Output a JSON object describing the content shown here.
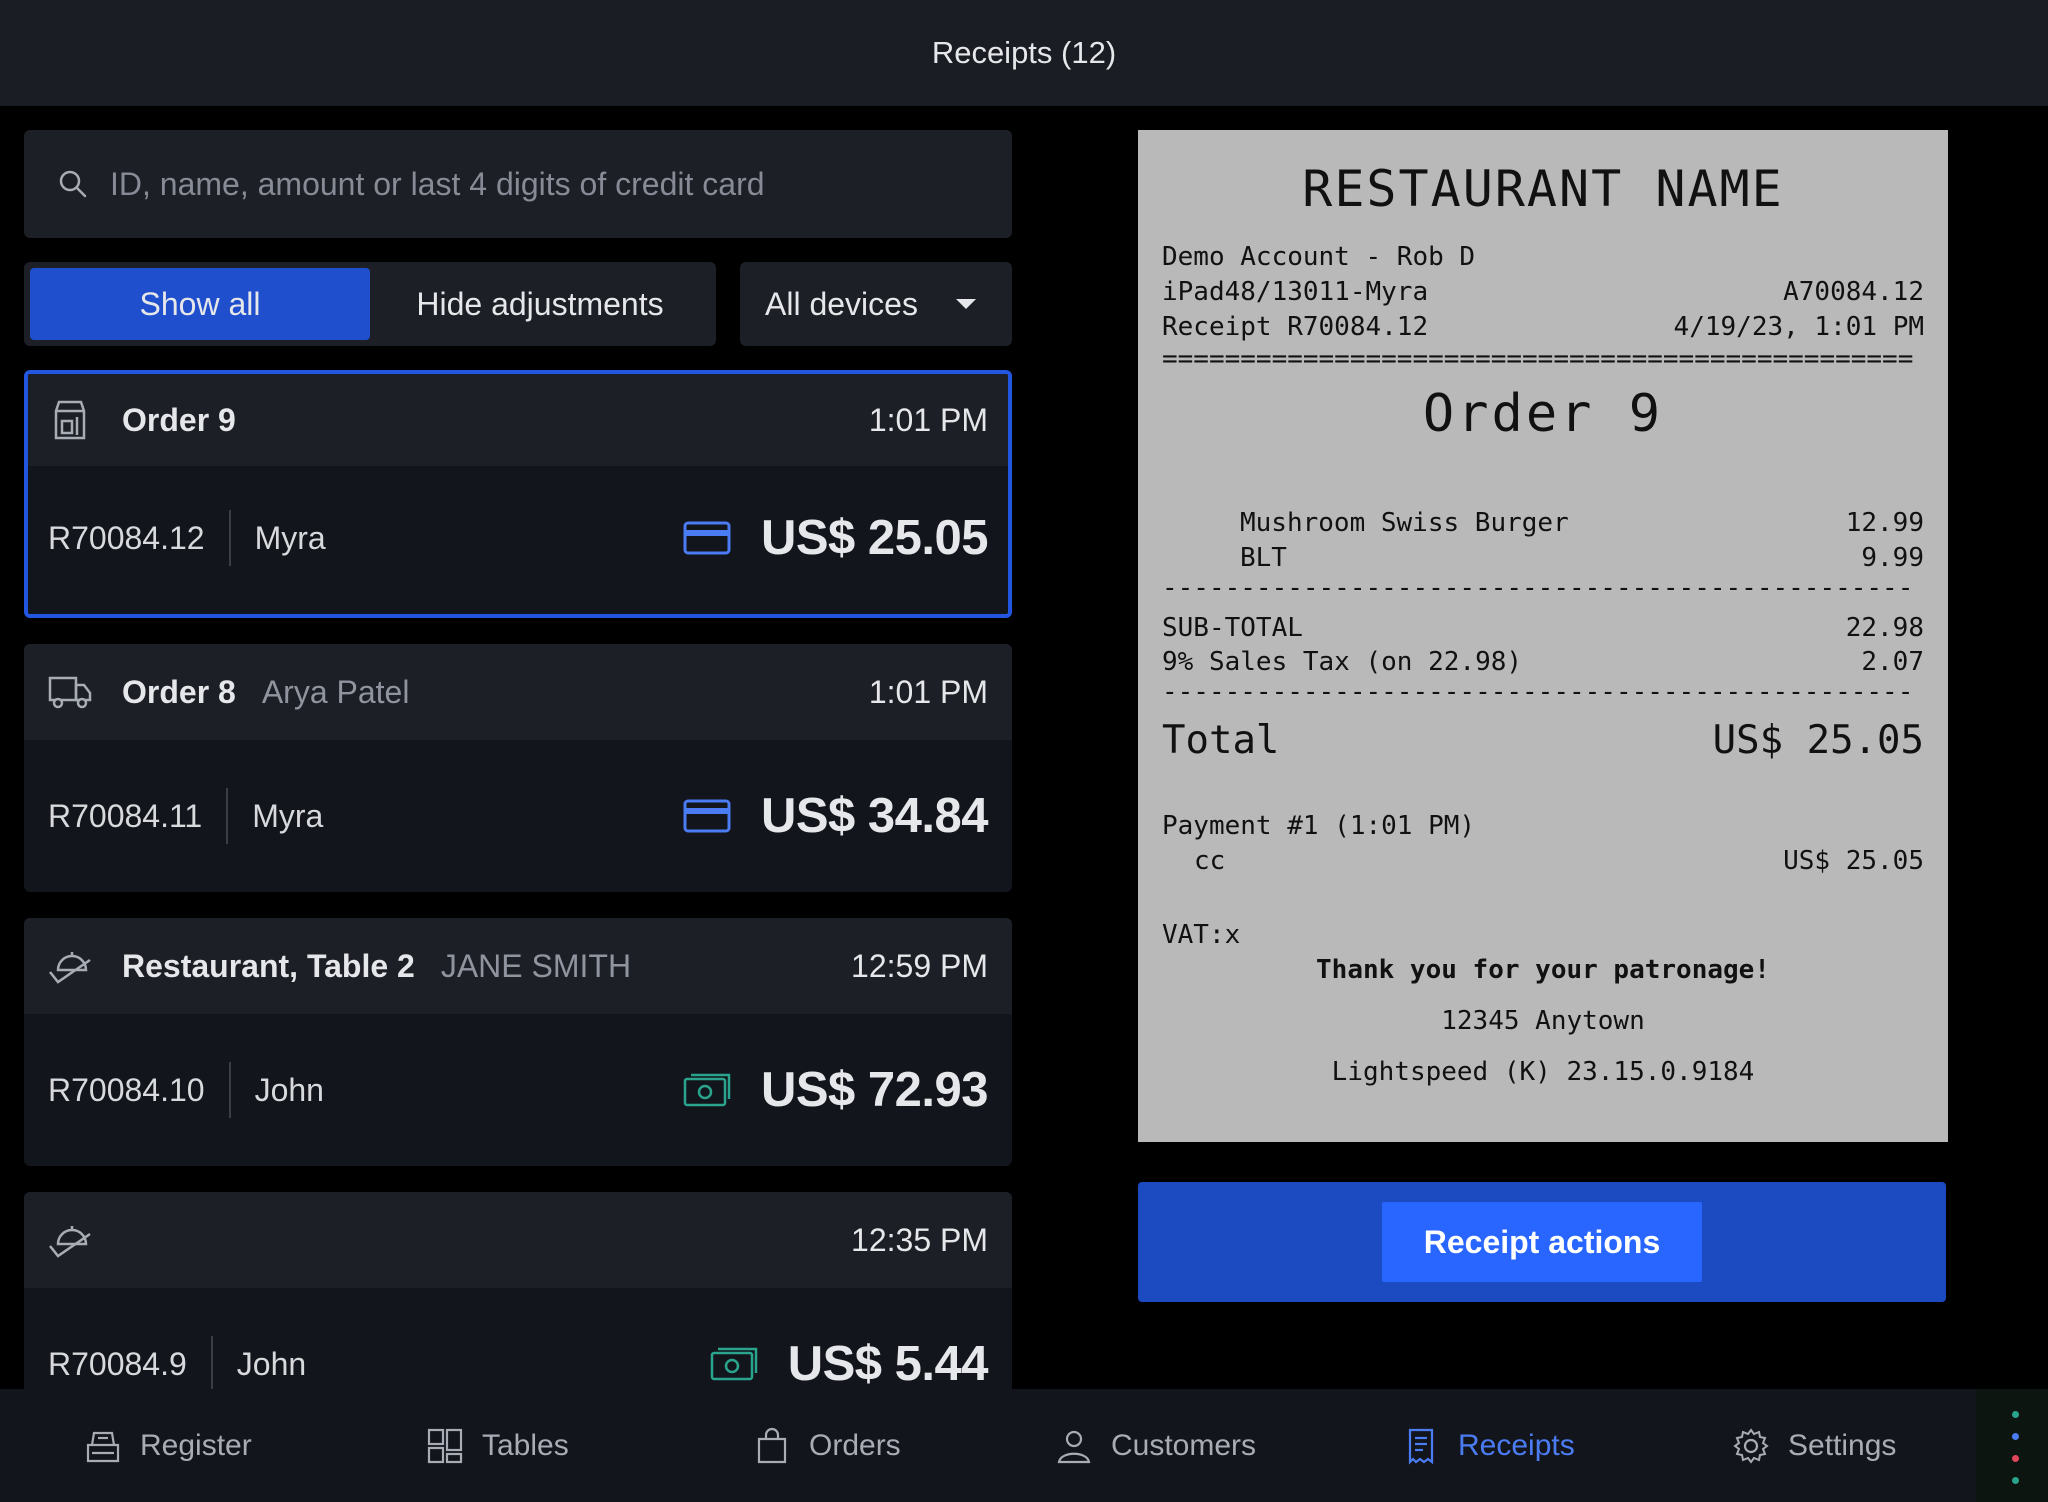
{
  "header": {
    "title": "Receipts (12)"
  },
  "search": {
    "placeholder": "ID, name, amount or last 4 digits of credit card"
  },
  "filters": {
    "show_all": "Show all",
    "hide_adjustments": "Hide adjustments",
    "devices": "All devices"
  },
  "receipts": [
    {
      "order": "Order 9",
      "customer": "",
      "time": "1:01 PM",
      "id": "R70084.12",
      "employee": "Myra",
      "amount": "US$ 25.05",
      "payment_icon": "credit-card-icon",
      "type_icon": "store-icon"
    },
    {
      "order": "Order 8",
      "customer": "Arya  Patel",
      "time": "1:01 PM",
      "id": "R70084.11",
      "employee": "Myra",
      "amount": "US$ 34.84",
      "payment_icon": "credit-card-icon",
      "type_icon": "delivery-truck-icon"
    },
    {
      "order": "Restaurant, Table 2",
      "customer": "JANE SMITH",
      "time": "12:59 PM",
      "id": "R70084.10",
      "employee": "John",
      "amount": "US$ 72.93",
      "payment_icon": "cash-icon",
      "type_icon": "dine-in-icon"
    },
    {
      "order": "",
      "customer": "",
      "time": "12:35 PM",
      "id": "R70084.9",
      "employee": "John",
      "amount": "US$ 5.44",
      "payment_icon": "cash-icon",
      "type_icon": "dine-in-icon"
    }
  ],
  "receipt_preview": {
    "restaurant": "RESTAURANT NAME",
    "account": "Demo Account - Rob D",
    "device": "iPad48/13011-Myra",
    "device_ref": "A70084.12",
    "receipt_no": "Receipt R70084.12",
    "datetime": "4/19/23, 1:01 PM",
    "double_rule": "================================================",
    "rule": "------------------------------------------------",
    "order": "Order 9",
    "items": [
      {
        "name": "Mushroom Swiss Burger",
        "price": "12.99"
      },
      {
        "name": "BLT",
        "price": "9.99"
      }
    ],
    "subtotal_label": "SUB-TOTAL",
    "subtotal": "22.98",
    "tax_label": "9% Sales Tax (on 22.98)",
    "tax": "2.07",
    "total_label": "Total",
    "total": "US$ 25.05",
    "payment_label": "Payment #1 (1:01 PM)",
    "payment_method": "cc",
    "payment_amount": "US$ 25.05",
    "vat": "VAT:x",
    "thanks": "Thank you for your patronage!",
    "address": "12345 Anytown",
    "version": "Lightspeed (K) 23.15.0.9184"
  },
  "receipt_actions": "Receipt actions",
  "tabs": [
    {
      "label": "Register",
      "icon": "register-icon"
    },
    {
      "label": "Tables",
      "icon": "tables-icon"
    },
    {
      "label": "Orders",
      "icon": "shopping-bag-icon"
    },
    {
      "label": "Customers",
      "icon": "person-icon"
    },
    {
      "label": "Receipts",
      "icon": "receipt-icon",
      "active": true
    },
    {
      "label": "Settings",
      "icon": "gear-icon"
    }
  ],
  "colors": {
    "accent": "#2356e0",
    "active_tab": "#4b7cf3",
    "cash": "#2aa48c",
    "card": "#4b7cf3"
  }
}
